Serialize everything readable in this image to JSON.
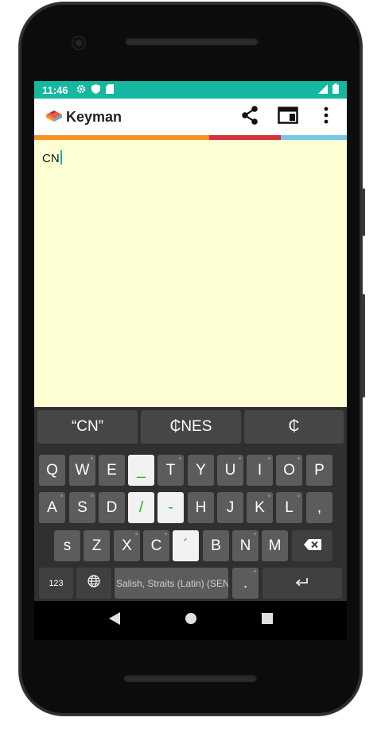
{
  "status": {
    "time": "11:46"
  },
  "app": {
    "name": "Keyman"
  },
  "colors": {
    "teal": "#14b8a0",
    "stripe_orange": "#f7941d",
    "stripe_red": "#d6313f",
    "stripe_blue": "#78c7e4",
    "editor_bg": "#ffffd4"
  },
  "editor": {
    "text": "CN"
  },
  "suggestions": [
    "“CN”",
    "₵NES",
    "₵"
  ],
  "keyboard": {
    "row1": [
      "Q",
      "W",
      "E",
      "_",
      "T",
      "Y",
      "U",
      "I",
      "O",
      "P"
    ],
    "row2": [
      "A",
      "S",
      "D",
      "/",
      "-",
      "H",
      "J",
      "K",
      "L",
      ","
    ],
    "row3": [
      "s",
      "Z",
      "X",
      "C",
      "´",
      "B",
      "N",
      "M"
    ],
    "numbers_label": "123",
    "language_label": "Salish, Straits (Latin) (SENĆ",
    "period_label": ".",
    "icons": {
      "backspace": "backspace-icon",
      "globe": "globe-icon",
      "enter": "enter-icon"
    }
  }
}
